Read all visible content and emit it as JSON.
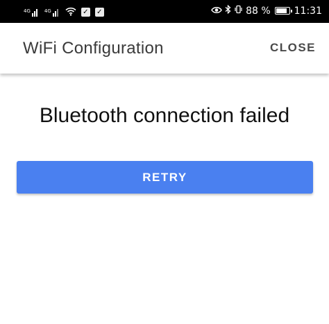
{
  "status_bar": {
    "battery_percent_label": "88 %",
    "battery_level": 0.88,
    "time": "11:31",
    "notification_check_1": "✓",
    "notification_check_2": "✓"
  },
  "app_bar": {
    "title": "WiFi Configuration",
    "close_label": "CLOSE"
  },
  "main": {
    "message": "Bluetooth connection failed",
    "retry_label": "RETRY"
  },
  "colors": {
    "primary_button": "#4a80f0",
    "status_bar": "#000000"
  }
}
